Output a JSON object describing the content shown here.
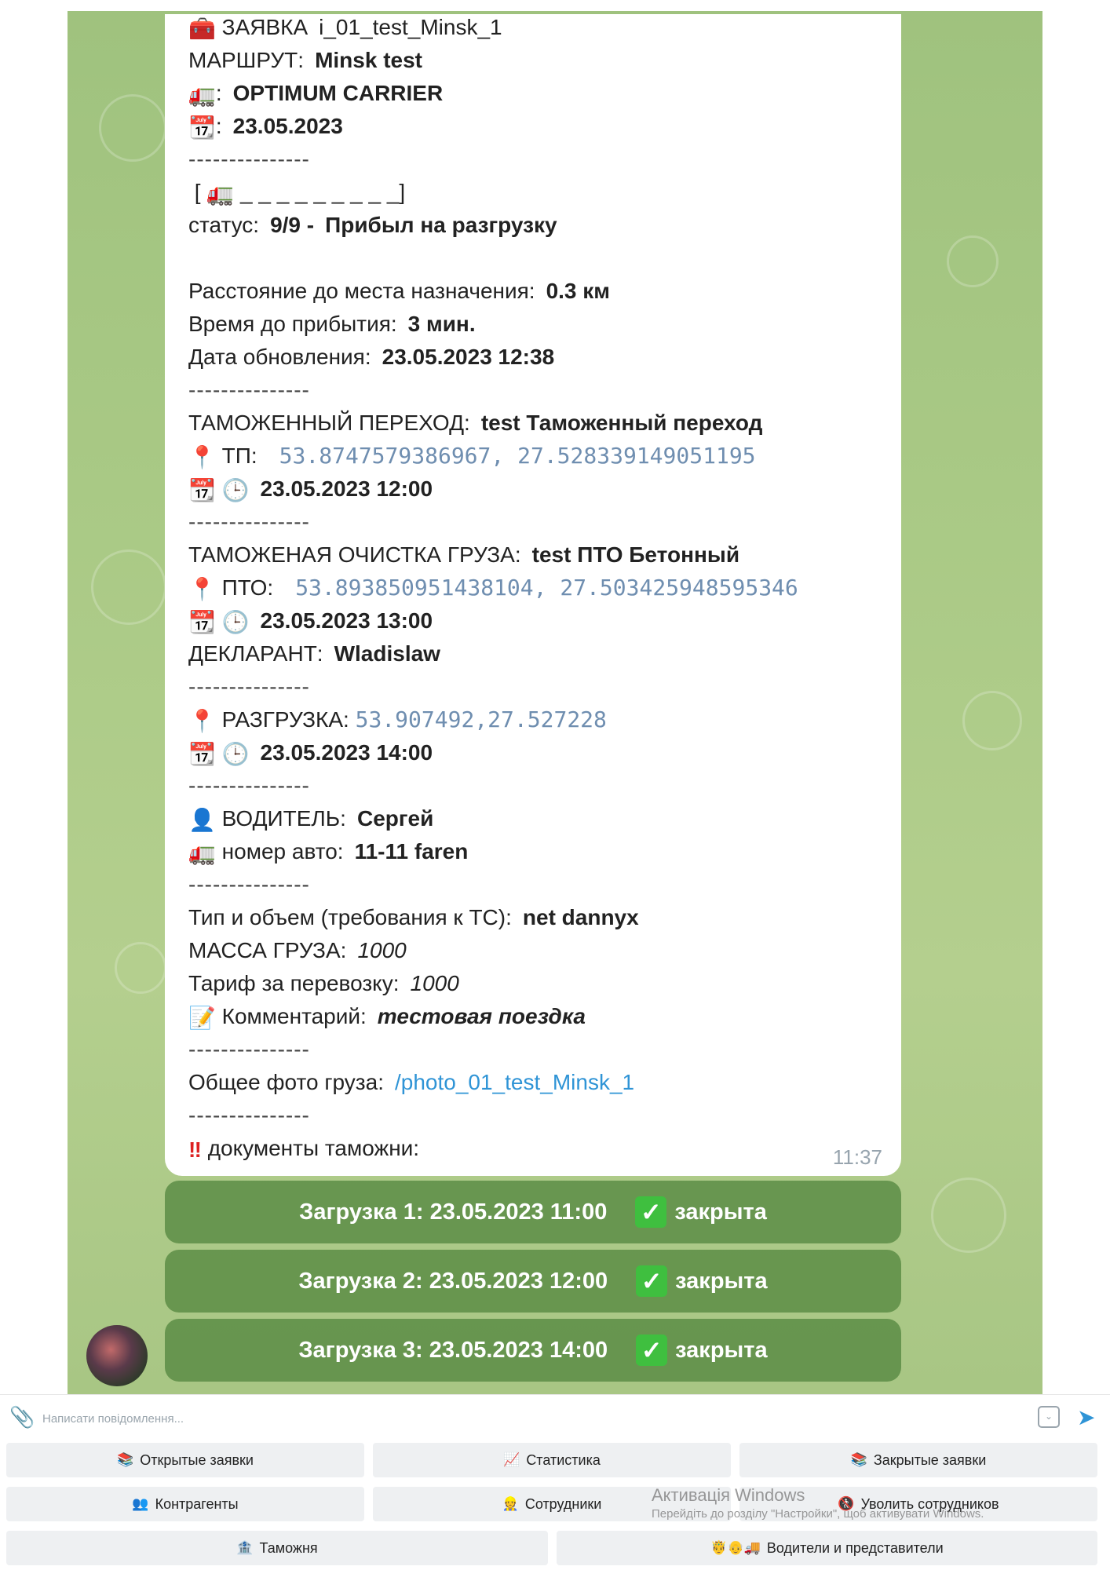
{
  "message": {
    "request_label": "ЗАЯВКА",
    "request_id": "i_01_test_Minsk_1",
    "route_label": "МАРШРУТ:",
    "route_value": "Minsk test",
    "carrier_value": "OPTIMUM CARRIER",
    "date_value": "23.05.2023",
    "separator": "---------------",
    "progress_bar": "_ _ _ _ _ _ _ _ _]",
    "progress_open": "[",
    "status_label": "статус:",
    "status_step": "9/9 -",
    "status_value": "Прибыл на разгрузку",
    "distance_label": "Расстояние до места назначения:",
    "distance_value": "0.3 км",
    "eta_label": "Время до прибытия:",
    "eta_value": "3 мин.",
    "updated_label": "Дата обновления:",
    "updated_value": "23.05.2023  12:38",
    "customs_label": "ТАМОЖЕННЫЙ ПЕРЕХОД:",
    "customs_value": "test Таможенный переход",
    "tp_label": "ТП:",
    "tp_coords": "53.8747579386967, 27.528339149051195",
    "tp_datetime": "23.05.2023  12:00",
    "clearance_label": "ТАМОЖЕНАЯ ОЧИСТКА ГРУЗА:",
    "clearance_value": "test ПТО Бетонный",
    "pto_label": "ПТО:",
    "pto_coords": "53.893850951438104, 27.503425948595346",
    "pto_datetime": "23.05.2023  13:00",
    "declarant_label": "ДЕКЛАРАНТ:",
    "declarant_value": "Wladislaw",
    "unload_label": "РАЗГРУЗКА:",
    "unload_coords": "53.907492,27.527228",
    "unload_datetime": "23.05.2023  14:00",
    "driver_label": "ВОДИТЕЛЬ:",
    "driver_value": "Сергей",
    "plate_label": "номер авто:",
    "plate_value": "11-11 faren",
    "type_label": "Тип и объем (требования к ТС):",
    "type_value": "net dannyx",
    "mass_label": "МАССА ГРУЗА:",
    "mass_value": "1000",
    "tariff_label": "Тариф за перевозку:",
    "tariff_value": "1000",
    "comment_label": "Комментарий:",
    "comment_value": "тестовая поездка",
    "photo_label": "Общее фото груза:",
    "photo_link": "/photo_01_test_Minsk_1",
    "docs_label": "документы таможни:",
    "time": "11:37"
  },
  "inline_buttons": [
    {
      "label": "Загрузка 1: 23.05.2023 11:00",
      "state": "закрыта"
    },
    {
      "label": "Загрузка 2: 23.05.2023 12:00",
      "state": "закрыта"
    },
    {
      "label": "Загрузка 3: 23.05.2023 14:00",
      "state": "закрыта"
    }
  ],
  "input": {
    "placeholder": "Написати повідомлення..."
  },
  "keyboard": [
    {
      "label": "Открытые заявки",
      "emoji": "📚"
    },
    {
      "label": "Статистика",
      "emoji": "📈"
    },
    {
      "label": "Закрытые заявки",
      "emoji": "📚"
    },
    {
      "label": "Контрагенты",
      "emoji": "👥"
    },
    {
      "label": "Сотрудники",
      "emoji": "👷"
    },
    {
      "label": "Уволить сотрудников",
      "emoji": "🚷"
    },
    {
      "label": "Таможня",
      "emoji": "🏦"
    },
    {
      "label": "Водители и представители",
      "emoji": "🤴👴🚚"
    }
  ],
  "activation": {
    "title": "Активація Windows",
    "subtitle": "Перейдіть до розділу \"Настройки\", щоб активувати Windows."
  },
  "colors": {
    "accent": "#2f94d6",
    "bubble": "#ffffff",
    "chat_bg": "#a9c985",
    "button_bg": "#4e823a"
  }
}
